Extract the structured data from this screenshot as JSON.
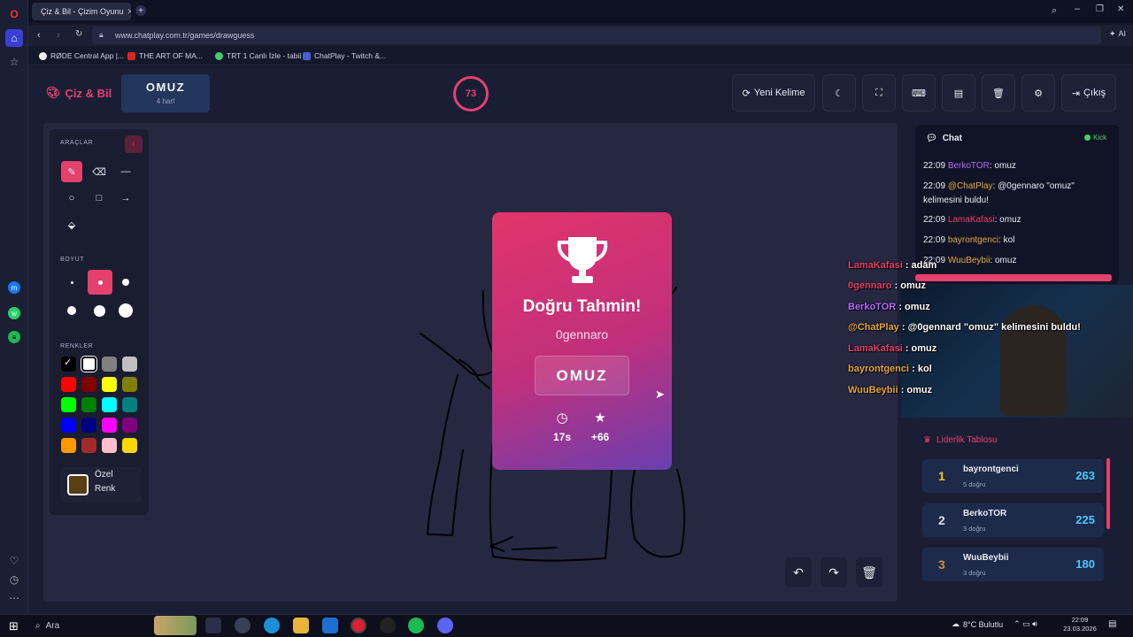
{
  "browser": {
    "tab_title": "Çiz & Bil - Çizim Oyunu",
    "url": "www.chatplay.com.tr/games/drawguess",
    "ai_label": "AI",
    "bookmarks": [
      "RØDE Central App |...",
      "THE ART OF MA...",
      "TRT 1 Canlı İzle - tabii",
      "ChatPlay - Twitch &..."
    ]
  },
  "header": {
    "logo": "Çiz & Bil",
    "word": "OMUZ",
    "word_hint": "4 harf",
    "timer": "73",
    "buttons": {
      "new_word": "Yeni Kelime",
      "exit": "Çıkış"
    }
  },
  "tools": {
    "tools_label": "ARAÇLAR",
    "size_label": "BOYUT",
    "colors_label": "RENKLER",
    "custom_color_line1": "Özel",
    "custom_color_line2": "Renk",
    "custom_color": "#5a3e14",
    "colors": [
      "#000000",
      "#ffffff",
      "#808080",
      "#c0c0c0",
      "#ff0000",
      "#800000",
      "#ffff00",
      "#808000",
      "#00ff00",
      "#008000",
      "#00ffff",
      "#008080",
      "#0000ff",
      "#000080",
      "#ff00ff",
      "#800080",
      "#ff9900",
      "#a52a2a",
      "#ffc0cb",
      "#ffd700"
    ]
  },
  "result": {
    "title": "Doğru Tahmin!",
    "user": "0gennaro",
    "word": "OMUZ",
    "time": "17s",
    "points": "+66"
  },
  "chat": {
    "title": "Chat",
    "platform": "Kick",
    "messages": [
      {
        "time": "22:09",
        "user": "BerkoTOR",
        "user_color": "#b36bff",
        "text": ": omuz"
      },
      {
        "time": "22:09",
        "user": "@ChatPlay",
        "user_color": "#e7a83a",
        "text": ": @0gennaro \"omuz\" kelimesini buldu!"
      },
      {
        "time": "22:09",
        "user": "LamaKafasi",
        "user_color": "#e5416d",
        "text": ": omuz"
      },
      {
        "time": "22:09",
        "user": "bayrontgenci",
        "user_color": "#e7a83a",
        "text": ": kol"
      },
      {
        "time": "22:09",
        "user": "WuuBeybii",
        "user_color": "#e7a83a",
        "text": ": omuz"
      }
    ]
  },
  "stream_overlay": [
    {
      "user": "LamaKafasi",
      "user_color": "#e5416d",
      "text": " : adam"
    },
    {
      "user": "0gennaro",
      "user_color": "#e5416d",
      "text": " : omuz"
    },
    {
      "user": "BerkoTOR",
      "user_color": "#b36bff",
      "text": " : omuz"
    },
    {
      "user": "@ChatPlay",
      "user_color": "#e7a83a",
      "text": " : @0gennard \"omuz\" kelimesini buldu!"
    },
    {
      "user": "LamaKafasi",
      "user_color": "#e5416d",
      "text": " : omuz"
    },
    {
      "user": "bayrontgenci",
      "user_color": "#e7a83a",
      "text": " : kol"
    },
    {
      "user": "WuuBeybii",
      "user_color": "#e7a83a",
      "text": " : omuz"
    }
  ],
  "leaderboard": {
    "title": "Liderlik Tablosu",
    "rows": [
      {
        "rank": "1",
        "name": "bayrontgenci",
        "sub": "5 doğru",
        "score": "263",
        "rank_color": "#f5c518"
      },
      {
        "rank": "2",
        "name": "BerkoTOR",
        "sub": "3 doğru",
        "score": "225",
        "rank_color": "#d9dbe6"
      },
      {
        "rank": "3",
        "name": "WuuBeybii",
        "sub": "3 doğru",
        "score": "180",
        "rank_color": "#d08a3c"
      }
    ]
  },
  "taskbar": {
    "search_placeholder": "Ara",
    "weather": "8°C Bulutlu",
    "time": "22:09",
    "date": "23.03.2026"
  }
}
